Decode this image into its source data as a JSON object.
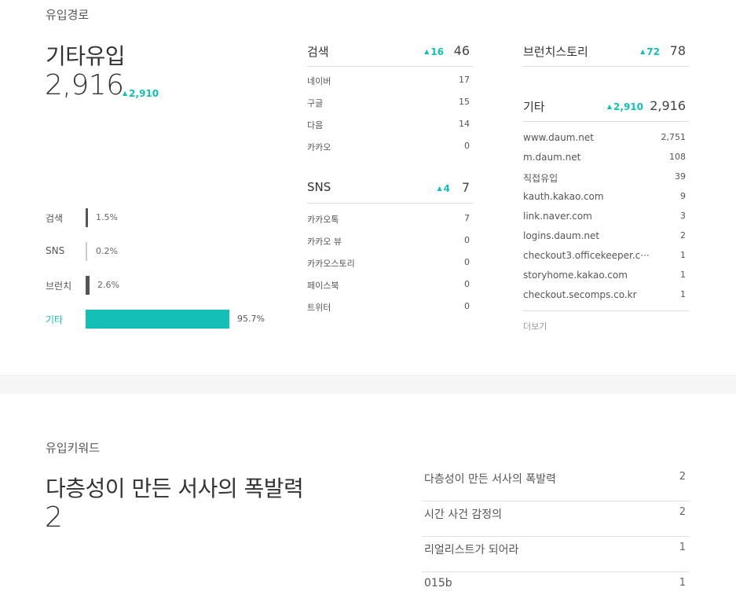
{
  "inflow": {
    "title": "유입경로",
    "selected": {
      "name": "기타유입",
      "count": "2,916",
      "delta": "2,910"
    },
    "ratios": [
      {
        "label": "검색",
        "pct": "1.5%",
        "value": 1.5
      },
      {
        "label": "SNS",
        "pct": "0.2%",
        "value": 0.2
      },
      {
        "label": "브런치",
        "pct": "2.6%",
        "value": 2.6
      },
      {
        "label": "기타",
        "pct": "95.7%",
        "value": 95.7
      }
    ],
    "search": {
      "name": "검색",
      "delta": "16",
      "count": "46",
      "items": [
        {
          "label": "네이버",
          "value": "17"
        },
        {
          "label": "구글",
          "value": "15"
        },
        {
          "label": "다음",
          "value": "14"
        },
        {
          "label": "카카오",
          "value": "0"
        }
      ]
    },
    "sns": {
      "name": "SNS",
      "delta": "4",
      "count": "7",
      "items": [
        {
          "label": "카카오톡",
          "value": "7"
        },
        {
          "label": "카카오 뷰",
          "value": "0"
        },
        {
          "label": "카카오스토리",
          "value": "0"
        },
        {
          "label": "페이스북",
          "value": "0"
        },
        {
          "label": "트위터",
          "value": "0"
        }
      ]
    },
    "brunch": {
      "name": "브런치스토리",
      "delta": "72",
      "count": "78"
    },
    "etc": {
      "name": "기타",
      "delta": "2,910",
      "count": "2,916",
      "items": [
        {
          "label": "www.daum.net",
          "value": "2,751"
        },
        {
          "label": "m.daum.net",
          "value": "108"
        },
        {
          "label": "직접유입",
          "value": "39"
        },
        {
          "label": "kauth.kakao.com",
          "value": "9"
        },
        {
          "label": "link.naver.com",
          "value": "3"
        },
        {
          "label": "logins.daum.net",
          "value": "2"
        },
        {
          "label": "checkout3.officekeeper.c···",
          "value": "1"
        },
        {
          "label": "storyhome.kakao.com",
          "value": "1"
        },
        {
          "label": "checkout.secomps.co.kr",
          "value": "1"
        }
      ],
      "more_label": "더보기"
    }
  },
  "keywords": {
    "title": "유입키워드",
    "selected": {
      "name": "다층성이 만든 서사의 폭발력",
      "count": "2"
    },
    "items": [
      {
        "label": "다층성이 만든 서사의 폭발력",
        "value": "2"
      },
      {
        "label": "시간 사건 감정의",
        "value": "2"
      },
      {
        "label": "리얼리스트가 되어라",
        "value": "1"
      },
      {
        "label": "015b",
        "value": "1"
      }
    ]
  },
  "colors": {
    "accent": "#13c0b8",
    "bar": "#555555"
  }
}
